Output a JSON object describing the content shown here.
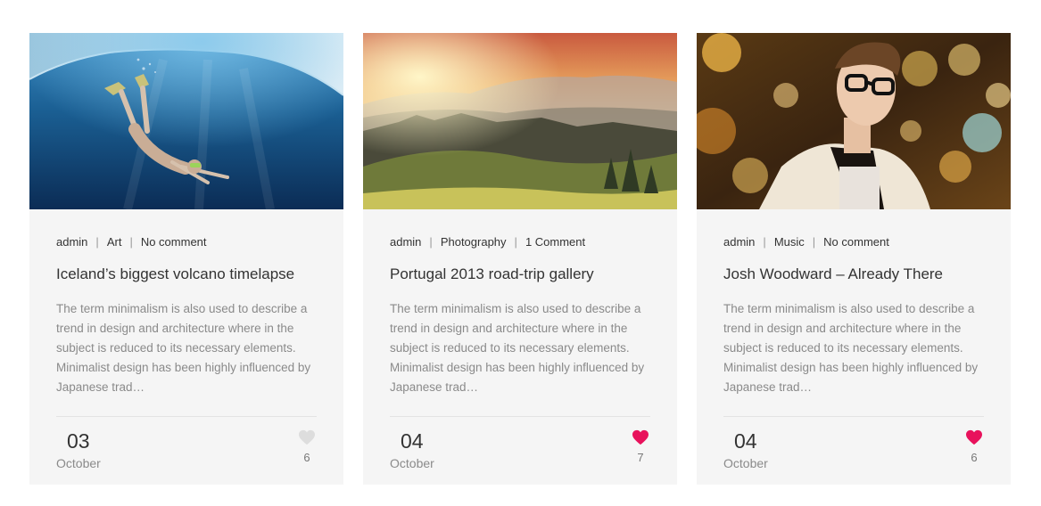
{
  "posts": [
    {
      "author": "admin",
      "category": "Art",
      "comments": "No comment",
      "title": "Iceland’s biggest volcano timelapse",
      "excerpt": "The term minimalism is also used to describe a trend in design and architecture where in the subject is reduced to its necessary elements. Minimalist design has been highly influenced by Japanese trad…",
      "day": "03",
      "month": "October",
      "likes": "6",
      "liked": false
    },
    {
      "author": "admin",
      "category": "Photography",
      "comments": "1 Comment",
      "title": "Portugal 2013 road-trip gallery",
      "excerpt": "The term minimalism is also used to describe a trend in design and architecture where in the subject is reduced to its necessary elements. Minimalist design has been highly influenced by Japanese trad…",
      "day": "04",
      "month": "October",
      "likes": "7",
      "liked": true
    },
    {
      "author": "admin",
      "category": "Music",
      "comments": "No comment",
      "title": "Josh Woodward – Already There",
      "excerpt": "The term minimalism is also used to describe a trend in design and architecture where in the subject is reduced to its necessary elements. Minimalist design has been highly influenced by Japanese trad…",
      "day": "04",
      "month": "October",
      "likes": "6",
      "liked": true
    }
  ],
  "colors": {
    "heart_active": "#e8125c",
    "heart_inactive": "#dddddd",
    "card_bg": "#f5f5f5"
  },
  "icons": {
    "like": "heart-icon"
  }
}
